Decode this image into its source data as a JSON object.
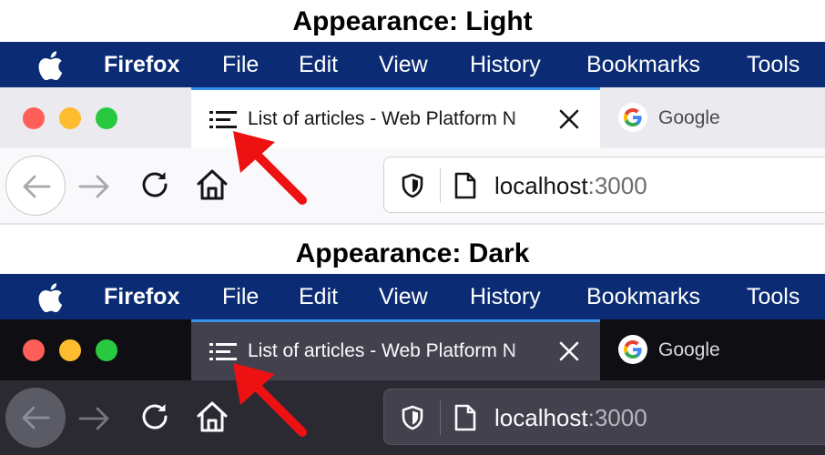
{
  "light": {
    "heading": "Appearance: Light",
    "menubar": {
      "app_name": "Firefox",
      "items": [
        "File",
        "Edit",
        "View",
        "History",
        "Bookmarks",
        "Tools"
      ]
    },
    "active_tab": {
      "title": "List of articles - Web Platform N",
      "icon": "list-icon"
    },
    "inactive_tab": {
      "title": "Google",
      "icon": "google-g-icon"
    },
    "url": {
      "host": "localhost",
      "port": ":3000"
    }
  },
  "dark": {
    "heading": "Appearance: Dark",
    "menubar": {
      "app_name": "Firefox",
      "items": [
        "File",
        "Edit",
        "View",
        "History",
        "Bookmarks",
        "Tools"
      ]
    },
    "active_tab": {
      "title": "List of articles - Web Platform N",
      "icon": "list-icon"
    },
    "inactive_tab": {
      "title": "Google",
      "icon": "google-g-icon"
    },
    "url": {
      "host": "localhost",
      "port": ":3000"
    }
  },
  "colors": {
    "menubar_bg": "#0b2c74",
    "tab_highlight": "#3592ea",
    "annotation_arrow": "#ee1111",
    "traffic_red": "#fe5f57",
    "traffic_yellow": "#febc2e",
    "traffic_green": "#28c840"
  }
}
